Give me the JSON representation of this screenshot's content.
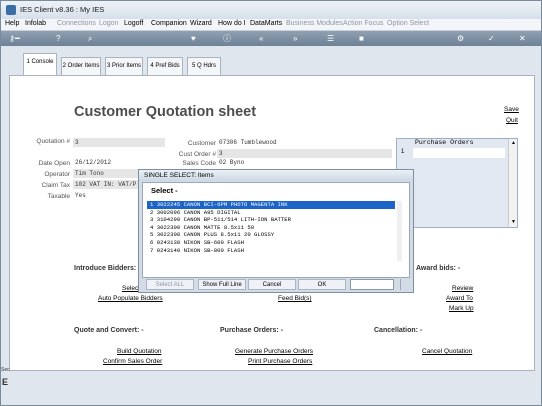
{
  "window": {
    "title": "IES Client v8.36 : My IES"
  },
  "menu": [
    {
      "label": "Help",
      "enabled": true
    },
    {
      "label": "Infolab",
      "enabled": true
    },
    {
      "label": "Connections",
      "enabled": false
    },
    {
      "label": "Logon",
      "enabled": false
    },
    {
      "label": "Logoff",
      "enabled": true
    },
    {
      "label": "Companion",
      "enabled": true
    },
    {
      "label": "Wizard",
      "enabled": true
    },
    {
      "label": "How do I",
      "enabled": true
    },
    {
      "label": "DataMarts",
      "enabled": true
    },
    {
      "label": "Business Modules",
      "enabled": false
    },
    {
      "label": "Action Focus",
      "enabled": false
    },
    {
      "label": "Option Select",
      "enabled": false
    }
  ],
  "tabs": [
    {
      "key": "1",
      "label": "Console"
    },
    {
      "key": "2",
      "label": "Order Items"
    },
    {
      "key": "3",
      "label": "Prior Items"
    },
    {
      "key": "4",
      "label": "Pref Bids"
    },
    {
      "key": "5",
      "label": "Q Hdrs"
    }
  ],
  "page": {
    "heading": "Customer Quotation sheet",
    "save_link": "Save",
    "quit_link": "Quit"
  },
  "form": {
    "quotation_label": "Quotation #",
    "quotation_value": "3",
    "date_open_label": "Date Open",
    "date_open_value": "26/12/2012",
    "operator_label": "Operator",
    "operator_value": "Tim Tono",
    "claim_tax_label": "Claim Tax",
    "claim_tax_value": "102 VAT IN: VAT/P",
    "taxable_label": "Taxable",
    "taxable_value": "Yes",
    "customer_label": "Customer",
    "customer_value": "07306 Tumblewood",
    "cust_order_label": "Cust Order #",
    "cust_order_value": "3",
    "sales_code_label": "Sales Code",
    "sales_code_value": "02 Byno"
  },
  "purchase_orders_grid": {
    "header": "Purchase Orders",
    "row_number": "1"
  },
  "bidders": {
    "title": "Introduce Bidders:",
    "select_link": "Selec",
    "auto_populate_link": "Auto Populate Bidders",
    "feed_bids_link": "Feed Bid(s)"
  },
  "award_bids": {
    "title": "Award bids: -",
    "review_link": "Review",
    "award_to_link": "Award To",
    "mark_up_link": "Mark Up"
  },
  "quote_convert": {
    "title": "Quote and Convert: -",
    "build_link": "Build Quotation",
    "confirm_link": "Confirm Sales Order"
  },
  "purchase_orders": {
    "title": "Purchase Orders: -",
    "generate_link": "Generate Purchase Orders",
    "print_link": "Print Purchase Orders"
  },
  "cancellation": {
    "title": "Cancellation: -",
    "cancel_link": "Cancel Quotation"
  },
  "dialog": {
    "title": "SINGLE SELECT: Items",
    "header": "Select -",
    "items": [
      "1   3022245 CANON BCI-6PM PHOTO MAGENTA INK",
      "2   3002096 CANON A95 DIGITAL",
      "3   3104290 CANON BP-511/514 LITH-ION BATTER",
      "4   3022300 CANON MATTE 8.5x11 50",
      "5   3022308 CANON PLUS 8.5x11 20 GLOSSY",
      "6   0243138 NIKON SB-600 FLASH",
      "7   0243140 NIKON SB-800 FLASH"
    ],
    "selected_index": 0,
    "buttons": {
      "select_all": "Select ALL",
      "show_full_line": "Show Full Line",
      "cancel": "Cancel",
      "ok": "OK"
    },
    "input_value": ""
  },
  "side_labels": {
    "sec": "Sec",
    "e": "E"
  }
}
